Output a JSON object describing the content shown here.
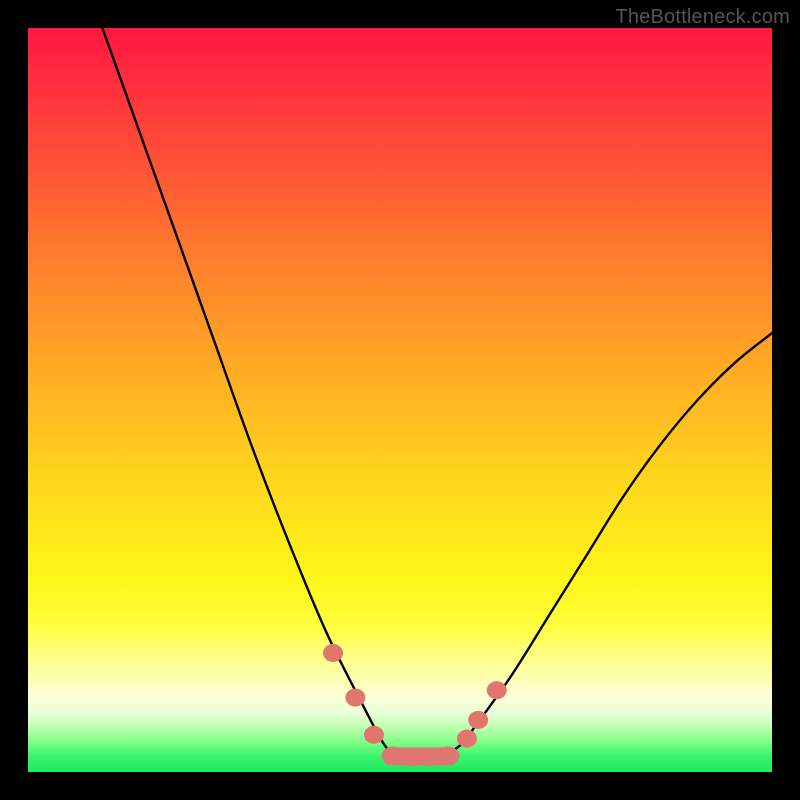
{
  "watermark": "TheBottleneck.com",
  "chart_data": {
    "type": "line",
    "title": "",
    "xlabel": "",
    "ylabel": "",
    "xlim": [
      0,
      100
    ],
    "ylim": [
      0,
      100
    ],
    "series": [
      {
        "name": "bottleneck-curve",
        "x": [
          10,
          15,
          20,
          25,
          30,
          35,
          40,
          45,
          48,
          50,
          52,
          55,
          58,
          60,
          65,
          70,
          75,
          80,
          85,
          90,
          95,
          100
        ],
        "values": [
          100,
          86,
          72,
          58,
          44,
          31,
          19,
          9,
          3.5,
          2,
          2,
          2,
          3.5,
          6,
          13,
          21,
          29,
          37,
          44,
          50,
          55,
          59
        ]
      }
    ],
    "markers": {
      "name": "flat-zone-markers",
      "color": "#e0766e",
      "points": [
        {
          "x": 41,
          "y": 16
        },
        {
          "x": 44,
          "y": 10
        },
        {
          "x": 46.5,
          "y": 5
        },
        {
          "x": 49,
          "y": 2.2
        },
        {
          "x": 51.5,
          "y": 2
        },
        {
          "x": 54,
          "y": 2
        },
        {
          "x": 56.5,
          "y": 2.2
        },
        {
          "x": 59,
          "y": 4.5
        },
        {
          "x": 60.5,
          "y": 7
        },
        {
          "x": 63,
          "y": 11
        }
      ]
    },
    "gradient_stops": [
      {
        "pos": 0.0,
        "color": "#ff173f"
      },
      {
        "pos": 0.3,
        "color": "#ff7a2e"
      },
      {
        "pos": 0.58,
        "color": "#ffcf1e"
      },
      {
        "pos": 0.8,
        "color": "#feff3a"
      },
      {
        "pos": 0.92,
        "color": "#e8ffd8"
      },
      {
        "pos": 1.0,
        "color": "#1de860"
      }
    ]
  }
}
